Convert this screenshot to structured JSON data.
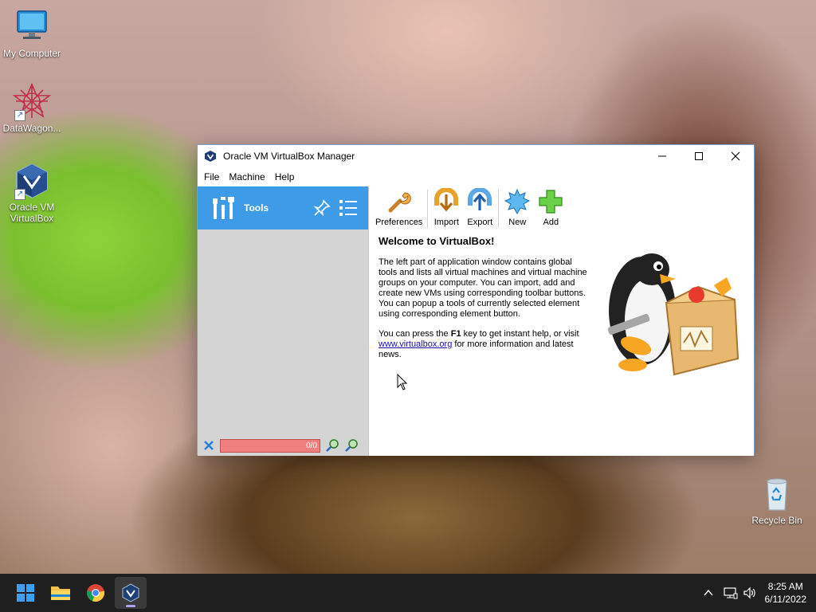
{
  "desktop": {
    "icons": [
      {
        "label": "My Computer",
        "icon": "monitor-icon"
      },
      {
        "label": "DataWagon...",
        "icon": "datawagon-icon"
      },
      {
        "label": "Oracle VM VirtualBox",
        "icon": "virtualbox-icon"
      },
      {
        "label": "Recycle Bin",
        "icon": "recycle-bin-icon"
      }
    ]
  },
  "window": {
    "title": "Oracle VM VirtualBox Manager",
    "menu": [
      "File",
      "Machine",
      "Help"
    ],
    "left_pane": {
      "tools_label": "Tools",
      "search_counter": "0/0"
    },
    "toolbar": [
      {
        "label": "Preferences",
        "icon": "preferences-icon"
      },
      {
        "label": "Import",
        "icon": "import-icon"
      },
      {
        "label": "Export",
        "icon": "export-icon"
      },
      {
        "label": "New",
        "icon": "new-icon"
      },
      {
        "label": "Add",
        "icon": "add-icon"
      }
    ],
    "welcome": {
      "heading": "Welcome to VirtualBox!",
      "para1": "The left part of application window contains global tools and lists all virtual machines and virtual machine groups on your computer. You can import, add and create new VMs using corresponding toolbar buttons. You can popup a tools of currently selected element using corresponding element button.",
      "para2_before": "You can press the ",
      "para2_key": "F1",
      "para2_middle": " key to get instant help, or visit ",
      "para2_link": "www.virtualbox.org",
      "para2_after": " for more information and latest news."
    }
  },
  "taskbar": {
    "time": "8:25 AM",
    "date": "6/11/2022",
    "apps": [
      "start-icon",
      "file-explorer-icon",
      "chrome-icon",
      "virtualbox-icon"
    ]
  },
  "colors": {
    "tools_selected": "#3e9be8",
    "left_pane_bg": "#d4d4d4",
    "search_bg": "#f08080",
    "taskbar": "#1f1f1f"
  }
}
